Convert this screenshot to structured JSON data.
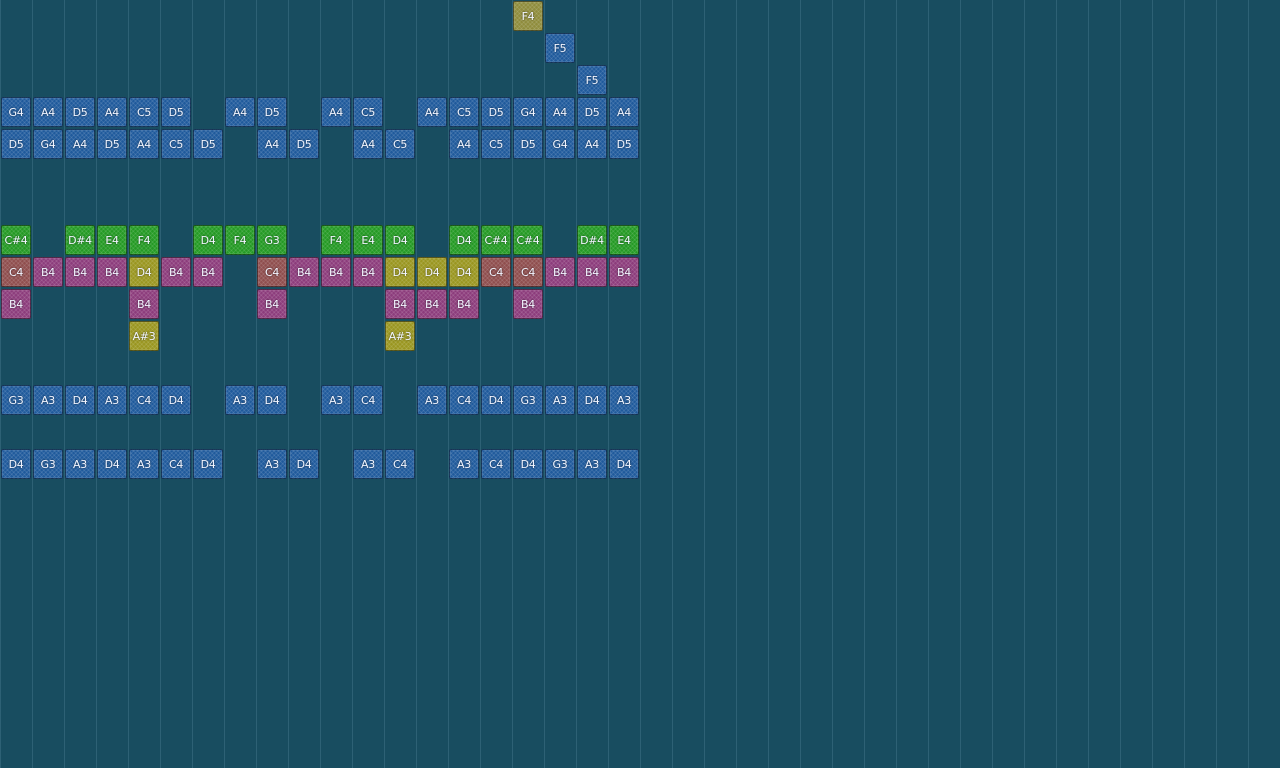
{
  "colors": {
    "background": "#184d60",
    "grid_line": "#3f7488",
    "blue": "#1f5a9c",
    "green": "#249a24",
    "purple": "#8c3c7c",
    "brown": "#8f4e4e",
    "olive": "#9a9620",
    "khaki": "#8f8c3c"
  },
  "notes": [
    {
      "col": 32,
      "row": 0,
      "label": "F4",
      "color": "khaki"
    },
    {
      "col": 34,
      "row": 1,
      "label": "F5",
      "color": "blue"
    },
    {
      "col": 36,
      "row": 2,
      "label": "F5",
      "color": "blue"
    },
    {
      "col": 0,
      "row": 3,
      "label": "G4",
      "color": "blue"
    },
    {
      "col": 2,
      "row": 3,
      "label": "A4",
      "color": "blue"
    },
    {
      "col": 4,
      "row": 3,
      "label": "D5",
      "color": "blue"
    },
    {
      "col": 6,
      "row": 3,
      "label": "A4",
      "color": "blue"
    },
    {
      "col": 8,
      "row": 3,
      "label": "C5",
      "color": "blue"
    },
    {
      "col": 10,
      "row": 3,
      "label": "D5",
      "color": "blue"
    },
    {
      "col": 14,
      "row": 3,
      "label": "A4",
      "color": "blue"
    },
    {
      "col": 16,
      "row": 3,
      "label": "D5",
      "color": "blue"
    },
    {
      "col": 20,
      "row": 3,
      "label": "A4",
      "color": "blue"
    },
    {
      "col": 22,
      "row": 3,
      "label": "C5",
      "color": "blue"
    },
    {
      "col": 26,
      "row": 3,
      "label": "A4",
      "color": "blue"
    },
    {
      "col": 28,
      "row": 3,
      "label": "C5",
      "color": "blue"
    },
    {
      "col": 30,
      "row": 3,
      "label": "D5",
      "color": "blue"
    },
    {
      "col": 32,
      "row": 3,
      "label": "G4",
      "color": "blue"
    },
    {
      "col": 34,
      "row": 3,
      "label": "A4",
      "color": "blue"
    },
    {
      "col": 36,
      "row": 3,
      "label": "D5",
      "color": "blue"
    },
    {
      "col": 38,
      "row": 3,
      "label": "A4",
      "color": "blue"
    },
    {
      "col": 0,
      "row": 4,
      "label": "D5",
      "color": "blue"
    },
    {
      "col": 2,
      "row": 4,
      "label": "G4",
      "color": "blue"
    },
    {
      "col": 4,
      "row": 4,
      "label": "A4",
      "color": "blue"
    },
    {
      "col": 6,
      "row": 4,
      "label": "D5",
      "color": "blue"
    },
    {
      "col": 8,
      "row": 4,
      "label": "A4",
      "color": "blue"
    },
    {
      "col": 10,
      "row": 4,
      "label": "C5",
      "color": "blue"
    },
    {
      "col": 12,
      "row": 4,
      "label": "D5",
      "color": "blue"
    },
    {
      "col": 16,
      "row": 4,
      "label": "A4",
      "color": "blue"
    },
    {
      "col": 18,
      "row": 4,
      "label": "D5",
      "color": "blue"
    },
    {
      "col": 22,
      "row": 4,
      "label": "A4",
      "color": "blue"
    },
    {
      "col": 24,
      "row": 4,
      "label": "C5",
      "color": "blue"
    },
    {
      "col": 28,
      "row": 4,
      "label": "A4",
      "color": "blue"
    },
    {
      "col": 30,
      "row": 4,
      "label": "C5",
      "color": "blue"
    },
    {
      "col": 32,
      "row": 4,
      "label": "D5",
      "color": "blue"
    },
    {
      "col": 34,
      "row": 4,
      "label": "G4",
      "color": "blue"
    },
    {
      "col": 36,
      "row": 4,
      "label": "A4",
      "color": "blue"
    },
    {
      "col": 38,
      "row": 4,
      "label": "D5",
      "color": "blue"
    },
    {
      "col": 0,
      "row": 7,
      "label": "C#4",
      "color": "green"
    },
    {
      "col": 4,
      "row": 7,
      "label": "D#4",
      "color": "green"
    },
    {
      "col": 6,
      "row": 7,
      "label": "E4",
      "color": "green"
    },
    {
      "col": 8,
      "row": 7,
      "label": "F4",
      "color": "green"
    },
    {
      "col": 12,
      "row": 7,
      "label": "D4",
      "color": "green"
    },
    {
      "col": 14,
      "row": 7,
      "label": "F4",
      "color": "green"
    },
    {
      "col": 16,
      "row": 7,
      "label": "G3",
      "color": "green"
    },
    {
      "col": 20,
      "row": 7,
      "label": "F4",
      "color": "green"
    },
    {
      "col": 22,
      "row": 7,
      "label": "E4",
      "color": "green"
    },
    {
      "col": 24,
      "row": 7,
      "label": "D4",
      "color": "green"
    },
    {
      "col": 28,
      "row": 7,
      "label": "D4",
      "color": "green"
    },
    {
      "col": 30,
      "row": 7,
      "label": "C#4",
      "color": "green"
    },
    {
      "col": 32,
      "row": 7,
      "label": "C#4",
      "color": "green"
    },
    {
      "col": 36,
      "row": 7,
      "label": "D#4",
      "color": "green"
    },
    {
      "col": 38,
      "row": 7,
      "label": "E4",
      "color": "green"
    },
    {
      "col": 0,
      "row": 8,
      "label": "C4",
      "color": "brown"
    },
    {
      "col": 2,
      "row": 8,
      "label": "B4",
      "color": "purple"
    },
    {
      "col": 4,
      "row": 8,
      "label": "B4",
      "color": "purple"
    },
    {
      "col": 6,
      "row": 8,
      "label": "B4",
      "color": "purple"
    },
    {
      "col": 8,
      "row": 8,
      "label": "D4",
      "color": "olive"
    },
    {
      "col": 10,
      "row": 8,
      "label": "B4",
      "color": "purple"
    },
    {
      "col": 12,
      "row": 8,
      "label": "B4",
      "color": "purple"
    },
    {
      "col": 16,
      "row": 8,
      "label": "C4",
      "color": "brown"
    },
    {
      "col": 18,
      "row": 8,
      "label": "B4",
      "color": "purple"
    },
    {
      "col": 20,
      "row": 8,
      "label": "B4",
      "color": "purple"
    },
    {
      "col": 22,
      "row": 8,
      "label": "B4",
      "color": "purple"
    },
    {
      "col": 24,
      "row": 8,
      "label": "D4",
      "color": "olive"
    },
    {
      "col": 26,
      "row": 8,
      "label": "D4",
      "color": "olive"
    },
    {
      "col": 28,
      "row": 8,
      "label": "D4",
      "color": "olive"
    },
    {
      "col": 30,
      "row": 8,
      "label": "C4",
      "color": "brown"
    },
    {
      "col": 32,
      "row": 8,
      "label": "C4",
      "color": "brown"
    },
    {
      "col": 34,
      "row": 8,
      "label": "B4",
      "color": "purple"
    },
    {
      "col": 36,
      "row": 8,
      "label": "B4",
      "color": "purple"
    },
    {
      "col": 38,
      "row": 8,
      "label": "B4",
      "color": "purple"
    },
    {
      "col": 0,
      "row": 9,
      "label": "B4",
      "color": "purple"
    },
    {
      "col": 8,
      "row": 9,
      "label": "B4",
      "color": "purple"
    },
    {
      "col": 16,
      "row": 9,
      "label": "B4",
      "color": "purple"
    },
    {
      "col": 24,
      "row": 9,
      "label": "B4",
      "color": "purple"
    },
    {
      "col": 26,
      "row": 9,
      "label": "B4",
      "color": "purple"
    },
    {
      "col": 28,
      "row": 9,
      "label": "B4",
      "color": "purple"
    },
    {
      "col": 32,
      "row": 9,
      "label": "B4",
      "color": "purple"
    },
    {
      "col": 8,
      "row": 10,
      "label": "A#3",
      "color": "olive"
    },
    {
      "col": 24,
      "row": 10,
      "label": "A#3",
      "color": "olive"
    },
    {
      "col": 0,
      "row": 12,
      "label": "G3",
      "color": "blue"
    },
    {
      "col": 2,
      "row": 12,
      "label": "A3",
      "color": "blue"
    },
    {
      "col": 4,
      "row": 12,
      "label": "D4",
      "color": "blue"
    },
    {
      "col": 6,
      "row": 12,
      "label": "A3",
      "color": "blue"
    },
    {
      "col": 8,
      "row": 12,
      "label": "C4",
      "color": "blue"
    },
    {
      "col": 10,
      "row": 12,
      "label": "D4",
      "color": "blue"
    },
    {
      "col": 14,
      "row": 12,
      "label": "A3",
      "color": "blue"
    },
    {
      "col": 16,
      "row": 12,
      "label": "D4",
      "color": "blue"
    },
    {
      "col": 20,
      "row": 12,
      "label": "A3",
      "color": "blue"
    },
    {
      "col": 22,
      "row": 12,
      "label": "C4",
      "color": "blue"
    },
    {
      "col": 26,
      "row": 12,
      "label": "A3",
      "color": "blue"
    },
    {
      "col": 28,
      "row": 12,
      "label": "C4",
      "color": "blue"
    },
    {
      "col": 30,
      "row": 12,
      "label": "D4",
      "color": "blue"
    },
    {
      "col": 32,
      "row": 12,
      "label": "G3",
      "color": "blue"
    },
    {
      "col": 34,
      "row": 12,
      "label": "A3",
      "color": "blue"
    },
    {
      "col": 36,
      "row": 12,
      "label": "D4",
      "color": "blue"
    },
    {
      "col": 38,
      "row": 12,
      "label": "A3",
      "color": "blue"
    },
    {
      "col": 0,
      "row": 14,
      "label": "D4",
      "color": "blue"
    },
    {
      "col": 2,
      "row": 14,
      "label": "G3",
      "color": "blue"
    },
    {
      "col": 4,
      "row": 14,
      "label": "A3",
      "color": "blue"
    },
    {
      "col": 6,
      "row": 14,
      "label": "D4",
      "color": "blue"
    },
    {
      "col": 8,
      "row": 14,
      "label": "A3",
      "color": "blue"
    },
    {
      "col": 10,
      "row": 14,
      "label": "C4",
      "color": "blue"
    },
    {
      "col": 12,
      "row": 14,
      "label": "D4",
      "color": "blue"
    },
    {
      "col": 16,
      "row": 14,
      "label": "A3",
      "color": "blue"
    },
    {
      "col": 18,
      "row": 14,
      "label": "D4",
      "color": "blue"
    },
    {
      "col": 22,
      "row": 14,
      "label": "A3",
      "color": "blue"
    },
    {
      "col": 24,
      "row": 14,
      "label": "C4",
      "color": "blue"
    },
    {
      "col": 28,
      "row": 14,
      "label": "A3",
      "color": "blue"
    },
    {
      "col": 30,
      "row": 14,
      "label": "C4",
      "color": "blue"
    },
    {
      "col": 32,
      "row": 14,
      "label": "D4",
      "color": "blue"
    },
    {
      "col": 34,
      "row": 14,
      "label": "G3",
      "color": "blue"
    },
    {
      "col": 36,
      "row": 14,
      "label": "A3",
      "color": "blue"
    },
    {
      "col": 38,
      "row": 14,
      "label": "D4",
      "color": "blue"
    }
  ]
}
